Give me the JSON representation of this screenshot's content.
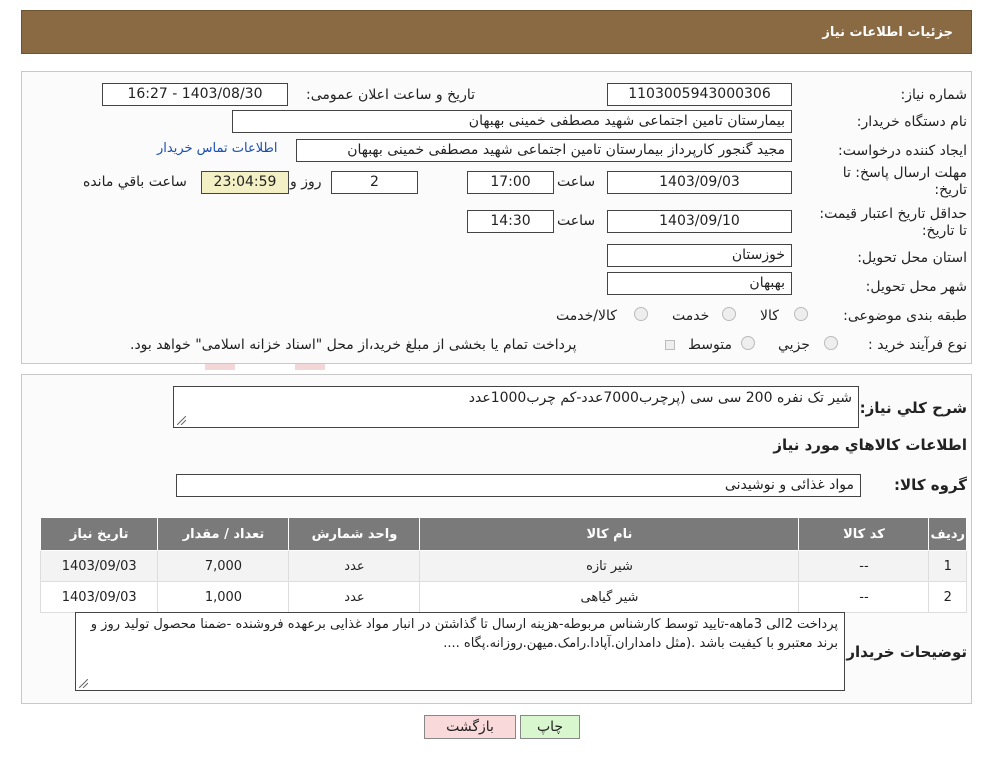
{
  "header": {
    "title": "جزئیات اطلاعات نیاز"
  },
  "form": {
    "need_number": {
      "label": "شماره نیاز:",
      "value": "1103005943000306"
    },
    "announce_datetime": {
      "label": "تاریخ و ساعت اعلان عمومی:",
      "value": "1403/08/30 - 16:27"
    },
    "buyer_org": {
      "label": "نام دستگاه خریدار:",
      "value": "بیمارستان تامین اجتماعی شهید مصطفی خمینی بهبهان"
    },
    "requester": {
      "label": "ایجاد کننده درخواست:",
      "value": "مجید گنجور کارپرداز بیمارستان تامین اجتماعی شهید مصطفی خمینی بهبهان",
      "contact_link": "اطلاعات تماس خریدار"
    },
    "deadline": {
      "label": "مهلت ارسال پاسخ: تا تاریخ:",
      "date": "1403/09/03",
      "time_label": "ساعت",
      "time": "17:00",
      "days": "2",
      "days_label": "روز و",
      "remaining": "23:04:59",
      "remaining_label": "ساعت باقي مانده"
    },
    "price_validity": {
      "label": "حداقل تاریخ اعتبار قیمت: تا تاریخ:",
      "date": "1403/09/10",
      "time_label": "ساعت",
      "time": "14:30"
    },
    "province": {
      "label": "استان محل تحویل:",
      "value": "خوزستان"
    },
    "city": {
      "label": "شهر محل تحویل:",
      "value": "بهبهان"
    },
    "category": {
      "label": "طبقه بندی موضوعی:",
      "options": [
        "کالا",
        "خدمت",
        "کالا/خدمت"
      ]
    },
    "process": {
      "label": "نوع فرآیند خرید :",
      "options": [
        "جزیي",
        "متوسط"
      ],
      "note": "پرداخت تمام یا بخشی از مبلغ خرید،از محل \"اسناد خزانه اسلامی\" خواهد بود."
    }
  },
  "description": {
    "label": "شرح کلي نیاز:",
    "value": "شیر تک نفره 200 سی سی (پرچرب7000عدد-کم چرب1000عدد"
  },
  "goods_section": {
    "title": "اطلاعات کالاهاي مورد نیاز",
    "group_label": "گروه کالا:",
    "group_value": "مواد غذائی و نوشیدنی"
  },
  "table": {
    "headers": [
      "ردیف",
      "کد کالا",
      "نام کالا",
      "واحد شمارش",
      "تعداد / مقدار",
      "تاریخ نیاز"
    ],
    "rows": [
      [
        "1",
        "--",
        "شیر تازه",
        "عدد",
        "7,000",
        "1403/09/03"
      ],
      [
        "2",
        "--",
        "شیر گیاهی",
        "عدد",
        "1,000",
        "1403/09/03"
      ]
    ]
  },
  "buyer_notes": {
    "label": "توضیحات خریدار:",
    "value": "پرداخت 2الی 3ماهه-تایید توسط کارشناس مربوطه-هزینه ارسال تا گذاشتن در انبار مواد غذایی برعهده فروشنده -ضمنا محصول تولید روز و برند معتبرو با کیفیت باشد .(مثل دامداران.آپادا.رامک.میهن.روزانه.پگاه ...."
  },
  "buttons": {
    "print": "چاپ",
    "back": "بازگشت"
  },
  "watermark": {
    "text": "AriaTender.neT"
  },
  "colors": {
    "header_bg": "#8a6a43",
    "remaining_bg": "#f3f0c5",
    "print_bg": "#d9f7cf",
    "back_bg": "#f9d9d9",
    "table_header_bg": "#7a7a7a",
    "link": "#1a4fb0"
  }
}
